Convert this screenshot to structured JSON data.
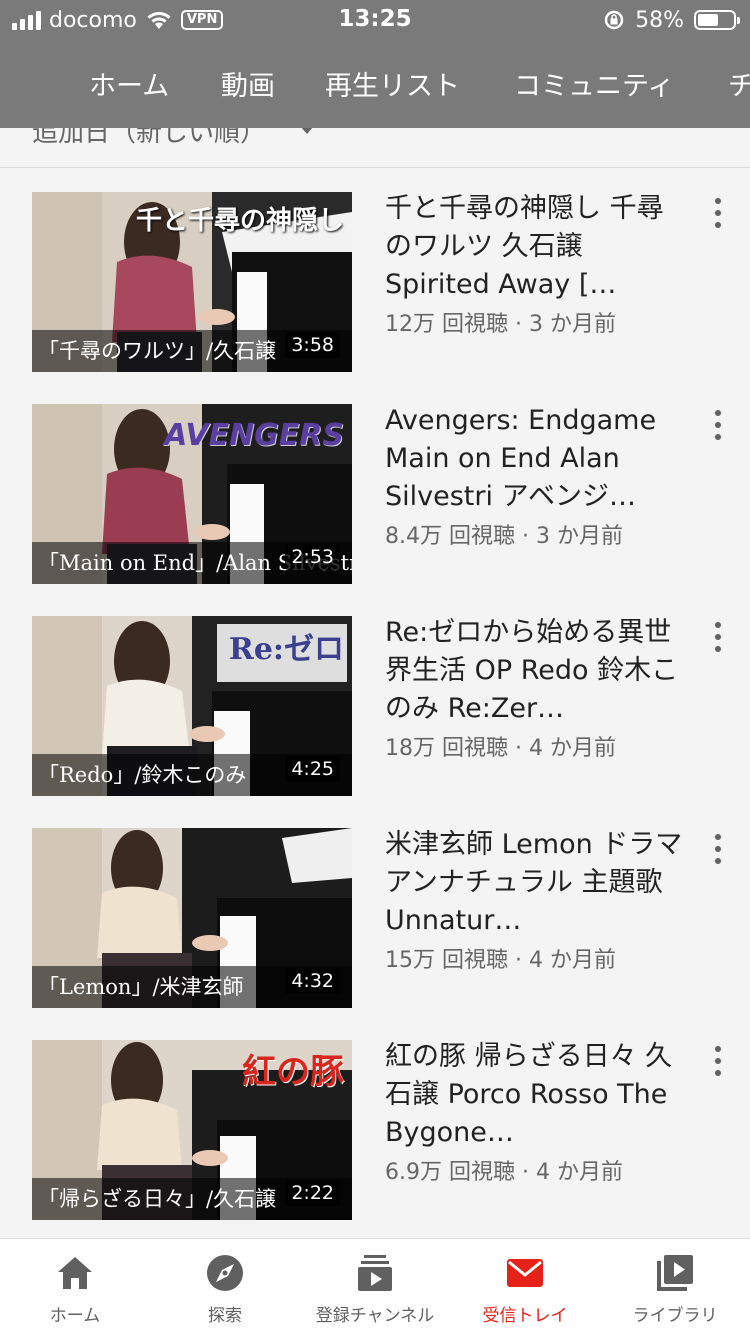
{
  "status_bar": {
    "carrier": "docomo",
    "vpn": "VPN",
    "time": "13:25",
    "battery": "58%",
    "battery_level": 0.58
  },
  "channel_tabs": [
    {
      "label": "ホーム"
    },
    {
      "label": "動画"
    },
    {
      "label": "再生リスト"
    },
    {
      "label": "コミュニティ"
    },
    {
      "label": "チ"
    }
  ],
  "sort": {
    "label": "追加日（新しい順）"
  },
  "videos": [
    {
      "title": "千と千尋の神隠し 千尋のワルツ 久石譲 Spirited Away […",
      "views": "12万 回視聴",
      "age": "3 か月前",
      "duration": "3:58",
      "thumb_caption": "「千尋のワルツ」/久石譲",
      "thumb_overlay": "千と千尋の神隠し"
    },
    {
      "title": "Avengers: Endgame Main on End Alan Silvestri アベンジ…",
      "views": "8.4万 回視聴",
      "age": "3 か月前",
      "duration": "2:53",
      "thumb_caption": "「Main on End」/Alan Silvestri",
      "thumb_overlay": "AVENGERS"
    },
    {
      "title": "Re:ゼロから始める異世界生活 OP Redo 鈴木このみ Re:Zer…",
      "views": "18万 回視聴",
      "age": "4 か月前",
      "duration": "4:25",
      "thumb_caption": "「Redo」/鈴木このみ",
      "thumb_overlay": "Re:ゼロ"
    },
    {
      "title": "米津玄師 Lemon ドラマ アンナチュラル 主題歌 Unnatur…",
      "views": "15万 回視聴",
      "age": "4 か月前",
      "duration": "4:32",
      "thumb_caption": "「Lemon」/米津玄師",
      "thumb_overlay": ""
    },
    {
      "title": "紅の豚 帰らざる日々 久石譲 Porco Rosso The Bygone…",
      "views": "6.9万 回視聴",
      "age": "4 か月前",
      "duration": "2:22",
      "thumb_caption": "「帰らざる日々」/久石譲",
      "thumb_overlay": "紅の豚"
    }
  ],
  "meta_separator": " · ",
  "bottom_nav": [
    {
      "label": "ホーム",
      "icon": "home-icon",
      "active": false
    },
    {
      "label": "探索",
      "icon": "compass-icon",
      "active": false
    },
    {
      "label": "登録チャンネル",
      "icon": "subscriptions-icon",
      "active": false
    },
    {
      "label": "受信トレイ",
      "icon": "inbox-icon",
      "active": true
    },
    {
      "label": "ライブラリ",
      "icon": "library-icon",
      "active": false
    }
  ],
  "colors": {
    "header_bg": "#7a7a7a",
    "accent_red": "#e62117",
    "text_primary": "#222222",
    "text_secondary": "#666666",
    "overlay_red": "#d9261c",
    "overlay_purple": "#5b3fa0"
  }
}
